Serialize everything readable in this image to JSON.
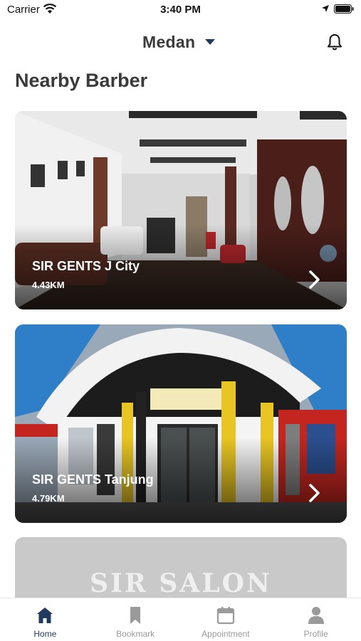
{
  "status_bar": {
    "carrier": "Carrier",
    "time": "3:40 PM"
  },
  "header": {
    "city": "Medan"
  },
  "section": {
    "title": "Nearby Barber"
  },
  "barbers": [
    {
      "name": "SIR GENTS J City",
      "distance": "4.43KM"
    },
    {
      "name": "SIR GENTS Tanjung",
      "distance": "4.79KM"
    }
  ],
  "partial_card": {
    "sign_text": "SIR SALON"
  },
  "tab_bar": {
    "active": "Home",
    "tabs": [
      {
        "label": "Home",
        "icon": "home-icon"
      },
      {
        "label": "Bookmark",
        "icon": "bookmark-icon"
      },
      {
        "label": "Appointment",
        "icon": "calendar-icon"
      },
      {
        "label": "Profile",
        "icon": "person-icon"
      }
    ]
  },
  "colors": {
    "accent": "#1f3a5c",
    "inactive": "#9a9a9a",
    "title": "#3a3a3a"
  }
}
